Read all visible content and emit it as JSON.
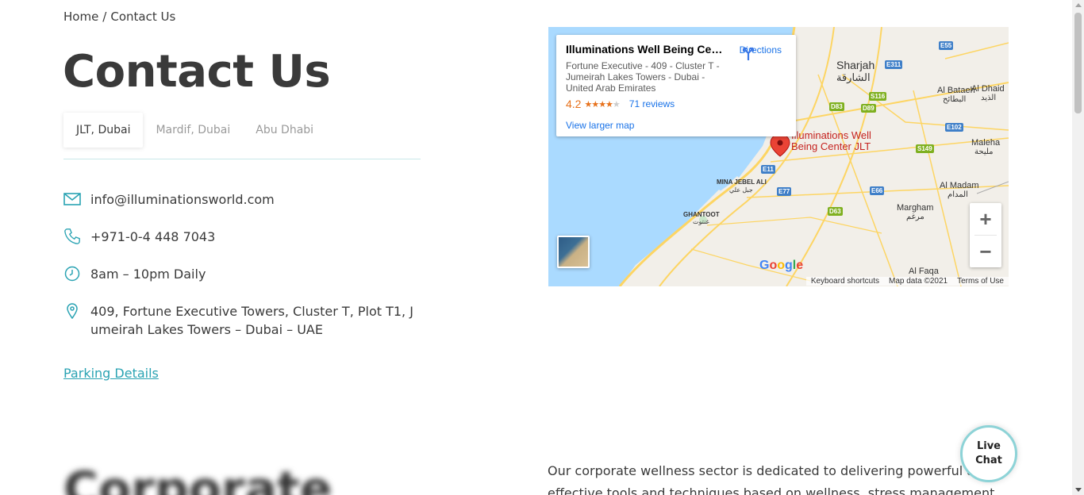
{
  "breadcrumb": {
    "home": "Home",
    "separator": "/",
    "current": "Contact Us"
  },
  "page": {
    "title": "Contact Us"
  },
  "tabs": [
    {
      "label": "JLT, Dubai",
      "active": true
    },
    {
      "label": "Mardif, Dubai",
      "active": false
    },
    {
      "label": "Abu Dhabi",
      "active": false
    }
  ],
  "contact": {
    "email": "info@illuminationsworld.com",
    "phone": "+971-0-4 448 7043",
    "hours": "8am – 10pm Daily",
    "address": "409, Fortune Executive Towers, Cluster T, Plot T1, Jumeirah Lakes Towers – Dubai – UAE",
    "parking_link": "Parking Details"
  },
  "map": {
    "place_name": "Illuminations Well Being Cent...",
    "place_address": "Fortune Executive - 409 - Cluster T - Jumeirah Lakes Towers - Dubai - United Arab Emirates",
    "rating": "4.2",
    "stars": "★★★★",
    "star_off": "★",
    "reviews": "71 reviews",
    "larger_map": "View larger map",
    "directions": "Directions",
    "marker_label_1": "Illuminations Well",
    "marker_label_2": "Being Center JLT",
    "zoom_in": "+",
    "zoom_out": "−",
    "google": "Google",
    "footer": {
      "shortcuts": "Keyboard shortcuts",
      "data": "Map data ©2021",
      "terms": "Terms of Use"
    },
    "labels": {
      "sharjah": "Sharjah",
      "sharjah_ar": "الشارقة",
      "al_bataeh": "Al Bataeh",
      "al_bataeh_ar": "البطائح",
      "al_dhaid": "Al Dhaid",
      "al_dhaid_ar": "الذيد",
      "maleha": "Maleha",
      "maleha_ar": "مليحة",
      "al_madam": "Al Madam",
      "al_madam_ar": "المدام",
      "margham": "Margham",
      "margham_ar": "مرغم",
      "mina_jebel_ali": "MINA JEBEL ALI",
      "mina_jebel_ali_ar": "جبل علي",
      "ghantoot": "GHANTOOT",
      "ghantoot_ar": "غنتوت",
      "al_faqa": "Al Faqa"
    },
    "shields": {
      "e55": "E55",
      "e311": "E311",
      "s116": "S116",
      "d83": "D83",
      "d89": "D89",
      "e102": "E102",
      "s149": "S149",
      "e11": "E11",
      "e77": "E77",
      "e66": "E66",
      "d63": "D63"
    }
  },
  "section": {
    "heading": "Corporate",
    "body_line_1": "Our corporate wellness sector is dedicated to delivering powerful a",
    "body_line_2": "effective tools and techniques based on wellness, stress management"
  },
  "live_chat": {
    "line1": "Live",
    "line2": "Chat"
  },
  "colors": {
    "accent": "#2aa3b3",
    "text": "#3a3a3a",
    "muted": "#9a9a9a",
    "water": "#aadaff",
    "land": "#f2efe9",
    "road": "#fdd563"
  }
}
